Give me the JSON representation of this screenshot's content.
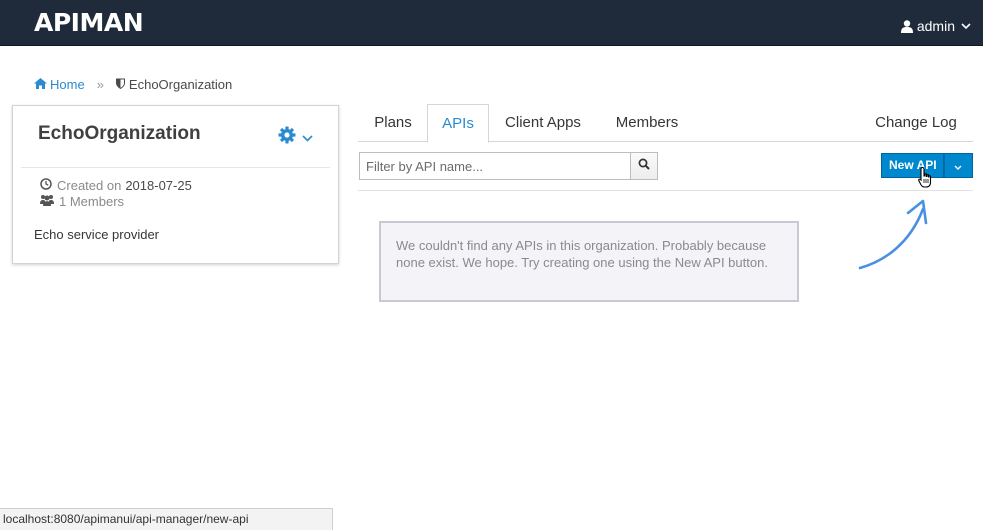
{
  "app": {
    "logo_text": "APIMAN"
  },
  "user_menu": {
    "username": "admin",
    "icon": "user-icon",
    "caret": "chevron-down-icon"
  },
  "breadcrumb": {
    "home_label": "Home",
    "home_icon": "home-icon",
    "separator": "»",
    "org_label": "EchoOrganization",
    "org_icon": "shield-icon"
  },
  "org": {
    "name": "EchoOrganization",
    "created_label": "Created on",
    "created_date": "2018-07-25",
    "members_label": "1 Members",
    "description": "Echo service provider"
  },
  "tabs": [
    {
      "label": "Plans",
      "active": false
    },
    {
      "label": "APIs",
      "active": true
    },
    {
      "label": "Client Apps",
      "active": false
    },
    {
      "label": "Members",
      "active": false
    },
    {
      "label": "Change Log",
      "active": false
    }
  ],
  "toolbar": {
    "filter_placeholder": "Filter by API name...",
    "filter_value": "",
    "new_api_label": "New API"
  },
  "empty_message": "We couldn't find any APIs in this organization. Probably because none exist. We hope. Try creating one using the New API button.",
  "status_url": "localhost:8080/apimanui/api-manager/new-api",
  "colors": {
    "topbar": "#1f2b3b",
    "accent": "#0088ce",
    "link": "#2a8bd1",
    "arrow": "#4a90e2"
  }
}
